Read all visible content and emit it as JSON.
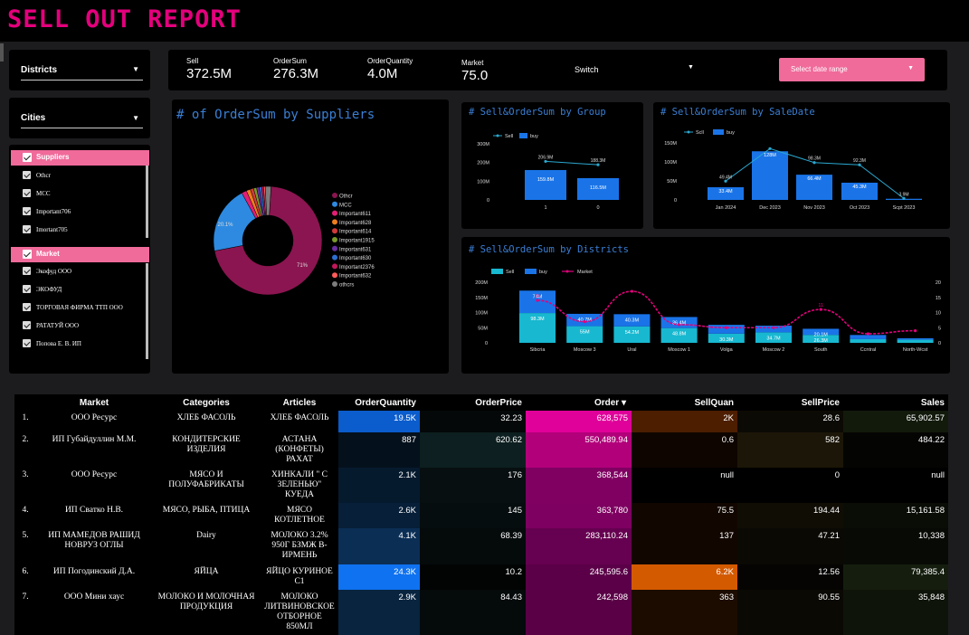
{
  "header": {
    "title": "SELL OUT REPORT"
  },
  "filters": {
    "districts_label": "Districts",
    "cities_label": "Cities",
    "switch_label": "Switch",
    "date_range_label": "Select date range"
  },
  "kpis": [
    {
      "label": "Sell",
      "value": "372.5M"
    },
    {
      "label": "OrderSum",
      "value": "276.3M"
    },
    {
      "label": "OrderQuantity",
      "value": "4.0M"
    },
    {
      "label": "Market",
      "value": "75.0"
    }
  ],
  "suppliers": {
    "header": "Suppliers",
    "items": [
      "Othcr",
      "MCC",
      "Important706",
      "Imortant705"
    ]
  },
  "market_list": {
    "header": "Market",
    "items": [
      "Экофуд ООО",
      "ЭКОФУД",
      "ТОРГОВАЯ ФИРМА ТТП ООО",
      "РАТАТУЙ ООО",
      "Попова Е. В. ИП"
    ]
  },
  "chart_data": [
    {
      "type": "pie",
      "title": "# of OrderSum by Suppliers",
      "labels": [
        "Othcr",
        "MCC",
        "Important611",
        "Important628",
        "Important614",
        "Important1915",
        "Important631",
        "Important630",
        "Important2376",
        "Important632",
        "othcrs"
      ],
      "values": [
        71,
        20.1,
        1.5,
        1.2,
        1,
        0.9,
        0.8,
        0.7,
        0.6,
        0.5,
        1.7
      ],
      "colors": [
        "#8b1550",
        "#2d8ae0",
        "#e21e74",
        "#f07d1e",
        "#d03a3a",
        "#7a9a2a",
        "#6a2fa0",
        "#2c6fd0",
        "#c2185b",
        "#ff5b5b",
        "#7d7d7d"
      ],
      "slice_labels": [
        "71%",
        "20.1%"
      ]
    },
    {
      "type": "bar",
      "title": "# Sell&OrderSum by Group",
      "legend": [
        "Sell",
        "buy"
      ],
      "categories": [
        "1",
        "0"
      ],
      "series": [
        {
          "name": "Sell",
          "type": "line",
          "values": [
            206,
            188
          ],
          "labels": [
            "206.9M",
            "188.3M"
          ]
        },
        {
          "name": "buy",
          "type": "bar",
          "values": [
            159.8,
            116.5
          ],
          "labels": [
            "159.8M",
            "116.5M"
          ]
        }
      ],
      "yticks": [
        "300M",
        "200M",
        "100M",
        "0"
      ],
      "ylim": [
        0,
        300
      ]
    },
    {
      "type": "bar",
      "title": "# Sell&OrderSum by SaleDate",
      "legend": [
        "Scll",
        "buy"
      ],
      "categories": [
        "Jan 2024",
        "Dec 2023",
        "Nov 2023",
        "Oct 2023",
        "Scpt 2023"
      ],
      "series": [
        {
          "name": "Scll",
          "type": "line",
          "values": [
            49.4,
            135,
            98.3,
            92.3,
            3.9
          ],
          "labels": [
            "49.4M",
            "",
            "98.3M",
            "92.3M",
            "3.9M"
          ]
        },
        {
          "name": "buy",
          "type": "bar",
          "values": [
            33.4,
            128,
            66.4,
            45.3,
            3
          ],
          "labels": [
            "33.4M",
            "128M",
            "66.4M",
            "45.3M",
            ""
          ]
        }
      ],
      "yticks": [
        "150M",
        "100M",
        "50M",
        "0"
      ],
      "ylim": [
        0,
        150
      ]
    },
    {
      "type": "bar",
      "title": "# Sell&OrderSum by Districts",
      "legend": [
        "Sell",
        "buy",
        "Market"
      ],
      "categories": [
        "Sibcria",
        "Moscow 3",
        "Ural",
        "Moscow 1",
        "Volga",
        "Moscow 2",
        "South",
        "Ccntral",
        "North-Wcst"
      ],
      "series": [
        {
          "name": "Sell",
          "type": "bar",
          "values": [
            98.3,
            55,
            54.2,
            48.8,
            30.3,
            34.7,
            26.3,
            12.1,
            10.2
          ],
          "labels": [
            "98.3M",
            "55M",
            "54.2M",
            "48.8M",
            "30.3M",
            "34.7M",
            "26.3M",
            "",
            ""
          ]
        },
        {
          "name": "buy",
          "type": "bar",
          "values": [
            74,
            40.7,
            40.3,
            36.4,
            29.1,
            21.9,
            20.1,
            13.8,
            5
          ],
          "labels": [
            "74M",
            "40.7M",
            "40.3M",
            "36.4M",
            "",
            "",
            "20.1M",
            "",
            ""
          ]
        },
        {
          "name": "Market",
          "type": "line",
          "values": [
            14,
            7,
            17,
            6,
            5,
            5,
            11,
            3,
            4
          ],
          "labels": [
            "14",
            "",
            "",
            "",
            "",
            "",
            "11",
            "",
            ""
          ]
        }
      ],
      "yticks_left": [
        "200M",
        "150M",
        "100M",
        "50M",
        "0"
      ],
      "yticks_right": [
        "20",
        "15",
        "10",
        "5",
        "0"
      ],
      "ylim": [
        0,
        200
      ],
      "y2lim": [
        0,
        20
      ]
    }
  ],
  "table": {
    "columns": [
      "Market",
      "Categories",
      "Articles",
      "OrderQuantity",
      "OrderPrice",
      "Order ▾",
      "SellQuan",
      "SellPrice",
      "Sales"
    ],
    "rows": [
      {
        "n": "1.",
        "market": "ООО Ресурс",
        "cat": "ХЛЕБ ФАСОЛЬ",
        "art": "ХЛЕБ ФАСОЛЬ",
        "oq": "19.5K",
        "op": "32.23",
        "order": "628,575",
        "sq": "2K",
        "sp": "28.6",
        "sales": "65,902.57"
      },
      {
        "n": "2.",
        "market": "ИП Губайдуллин М.М.",
        "cat": "КОНДИТЕРСКИЕ ИЗДЕЛИЯ",
        "art": "АСТАНА (КОНФЕТЫ) РАХАТ",
        "oq": "887",
        "op": "620.62",
        "order": "550,489.94",
        "sq": "0.6",
        "sp": "582",
        "sales": "484.22"
      },
      {
        "n": "3.",
        "market": "ООО Ресурс",
        "cat": "МЯСО И ПОЛУФАБРИКАТЫ",
        "art": "ХИНКАЛИ \" С ЗЕЛЕНЬЮ\" КУЕДА",
        "oq": "2.1K",
        "op": "176",
        "order": "368,544",
        "sq": "null",
        "sp": "0",
        "sales": "null"
      },
      {
        "n": "4.",
        "market": "ИП Сватко Н.В.",
        "cat": "МЯСО, РЫБА, ПТИЦА",
        "art": "МЯСО КОТЛЕТНОЕ",
        "oq": "2.6K",
        "op": "145",
        "order": "363,780",
        "sq": "75.5",
        "sp": "194.44",
        "sales": "15,161.58"
      },
      {
        "n": "5.",
        "market": "ИП МАМЕДОВ РАШИД НОВРУЗ ОГЛЫ",
        "cat": "Dairy",
        "art": "МОЛОКО 3.2% 950Г БЗМЖ В-ИРМЕНЬ",
        "oq": "4.1K",
        "op": "68.39",
        "order": "283,110.24",
        "sq": "137",
        "sp": "47.21",
        "sales": "10,338"
      },
      {
        "n": "6.",
        "market": "ИП Погодинский Д.А.",
        "cat": "ЯЙЦА",
        "art": "ЯЙЦО КУРИНОЕ С1",
        "oq": "24.3K",
        "op": "10.2",
        "order": "245,595.6",
        "sq": "6.2K",
        "sp": "12.56",
        "sales": "79,385.4"
      },
      {
        "n": "7.",
        "market": "ООО Мини хаус",
        "cat": "МОЛОКО И МОЛОЧНАЯ ПРОДУКЦИЯ",
        "art": "МОЛОКО ЛИТВИНОВСКОЕ ОТБОРНОЕ 850МЛ",
        "oq": "2.9K",
        "op": "84.43",
        "order": "242,598",
        "sq": "363",
        "sp": "90.55",
        "sales": "35,848"
      }
    ]
  }
}
